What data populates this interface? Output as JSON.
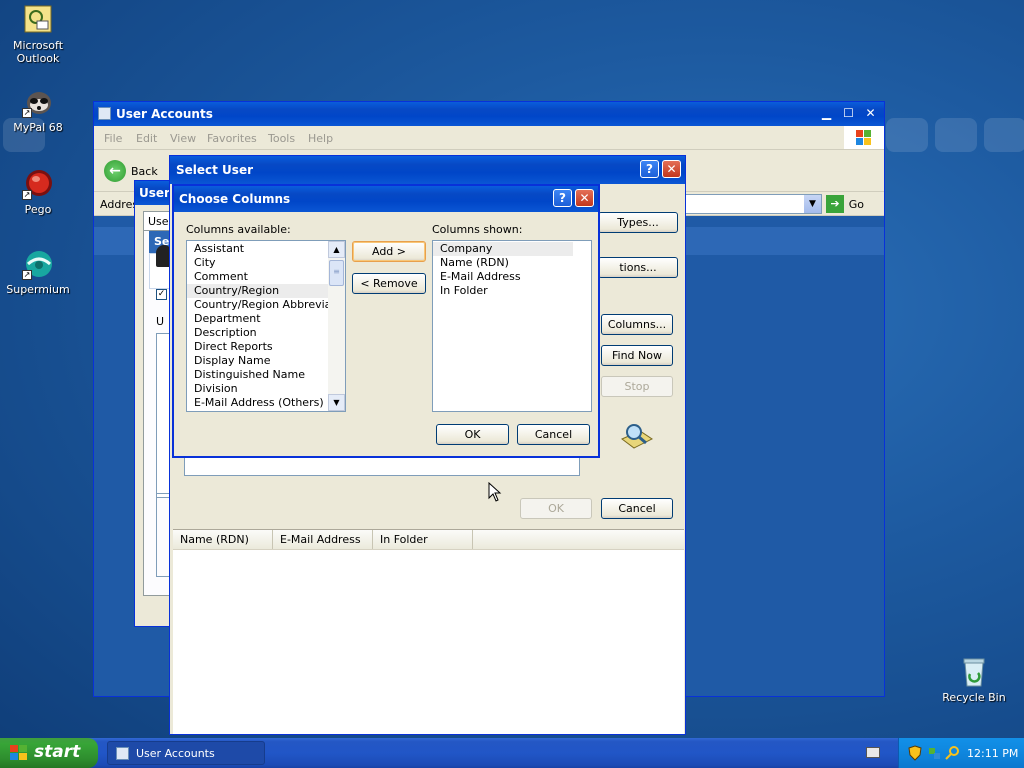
{
  "desktop": {
    "icons": [
      {
        "label": "Microsoft\nOutlook",
        "icon": "outlook-icon"
      },
      {
        "label": "MyPal 68",
        "icon": "mypal-icon"
      },
      {
        "label": "Pego",
        "icon": "pego-icon"
      },
      {
        "label": "Supermium",
        "icon": "supermium-icon"
      },
      {
        "label": "Recycle Bin",
        "icon": "recycle-bin-icon"
      }
    ]
  },
  "user_accounts": {
    "title": "User Accounts",
    "menu": [
      "File",
      "Edit",
      "View",
      "Favorites",
      "Tools",
      "Help"
    ],
    "back_label": "Back",
    "address_label": "Address",
    "go_label": "Go"
  },
  "behind_dialog": {
    "title": "User A",
    "tab": "User",
    "section": "Se",
    "partial_label": "U"
  },
  "select_user": {
    "title": "Select User",
    "buttons": {
      "types": "Types...",
      "locations": "tions...",
      "columns": "Columns...",
      "find_now": "Find Now",
      "stop": "Stop",
      "ok": "OK",
      "cancel": "Cancel"
    },
    "results_columns": [
      "Name (RDN)",
      "E-Mail Address",
      "In Folder"
    ]
  },
  "choose_columns": {
    "title": "Choose Columns",
    "available_label": "Columns available:",
    "shown_label": "Columns shown:",
    "available": [
      "Assistant",
      "City",
      "Comment",
      "Country/Region",
      "Country/Region Abbrevia...",
      "Department",
      "Description",
      "Direct Reports",
      "Display Name",
      "Distinguished Name",
      "Division",
      "E-Mail Address (Others)"
    ],
    "available_selected_index": 3,
    "shown": [
      "Company",
      "Name (RDN)",
      "E-Mail Address",
      "In Folder"
    ],
    "shown_selected_index": 0,
    "add_label": "Add >",
    "remove_label": "< Remove",
    "ok_label": "OK",
    "cancel_label": "Cancel"
  },
  "taskbar": {
    "start_label": "start",
    "task": "User Accounts",
    "clock": "12:11 PM"
  },
  "colors": {
    "title_blue": "#0a5ddc",
    "dialog_face": "#ece9d8",
    "start_green": "#37a537"
  }
}
